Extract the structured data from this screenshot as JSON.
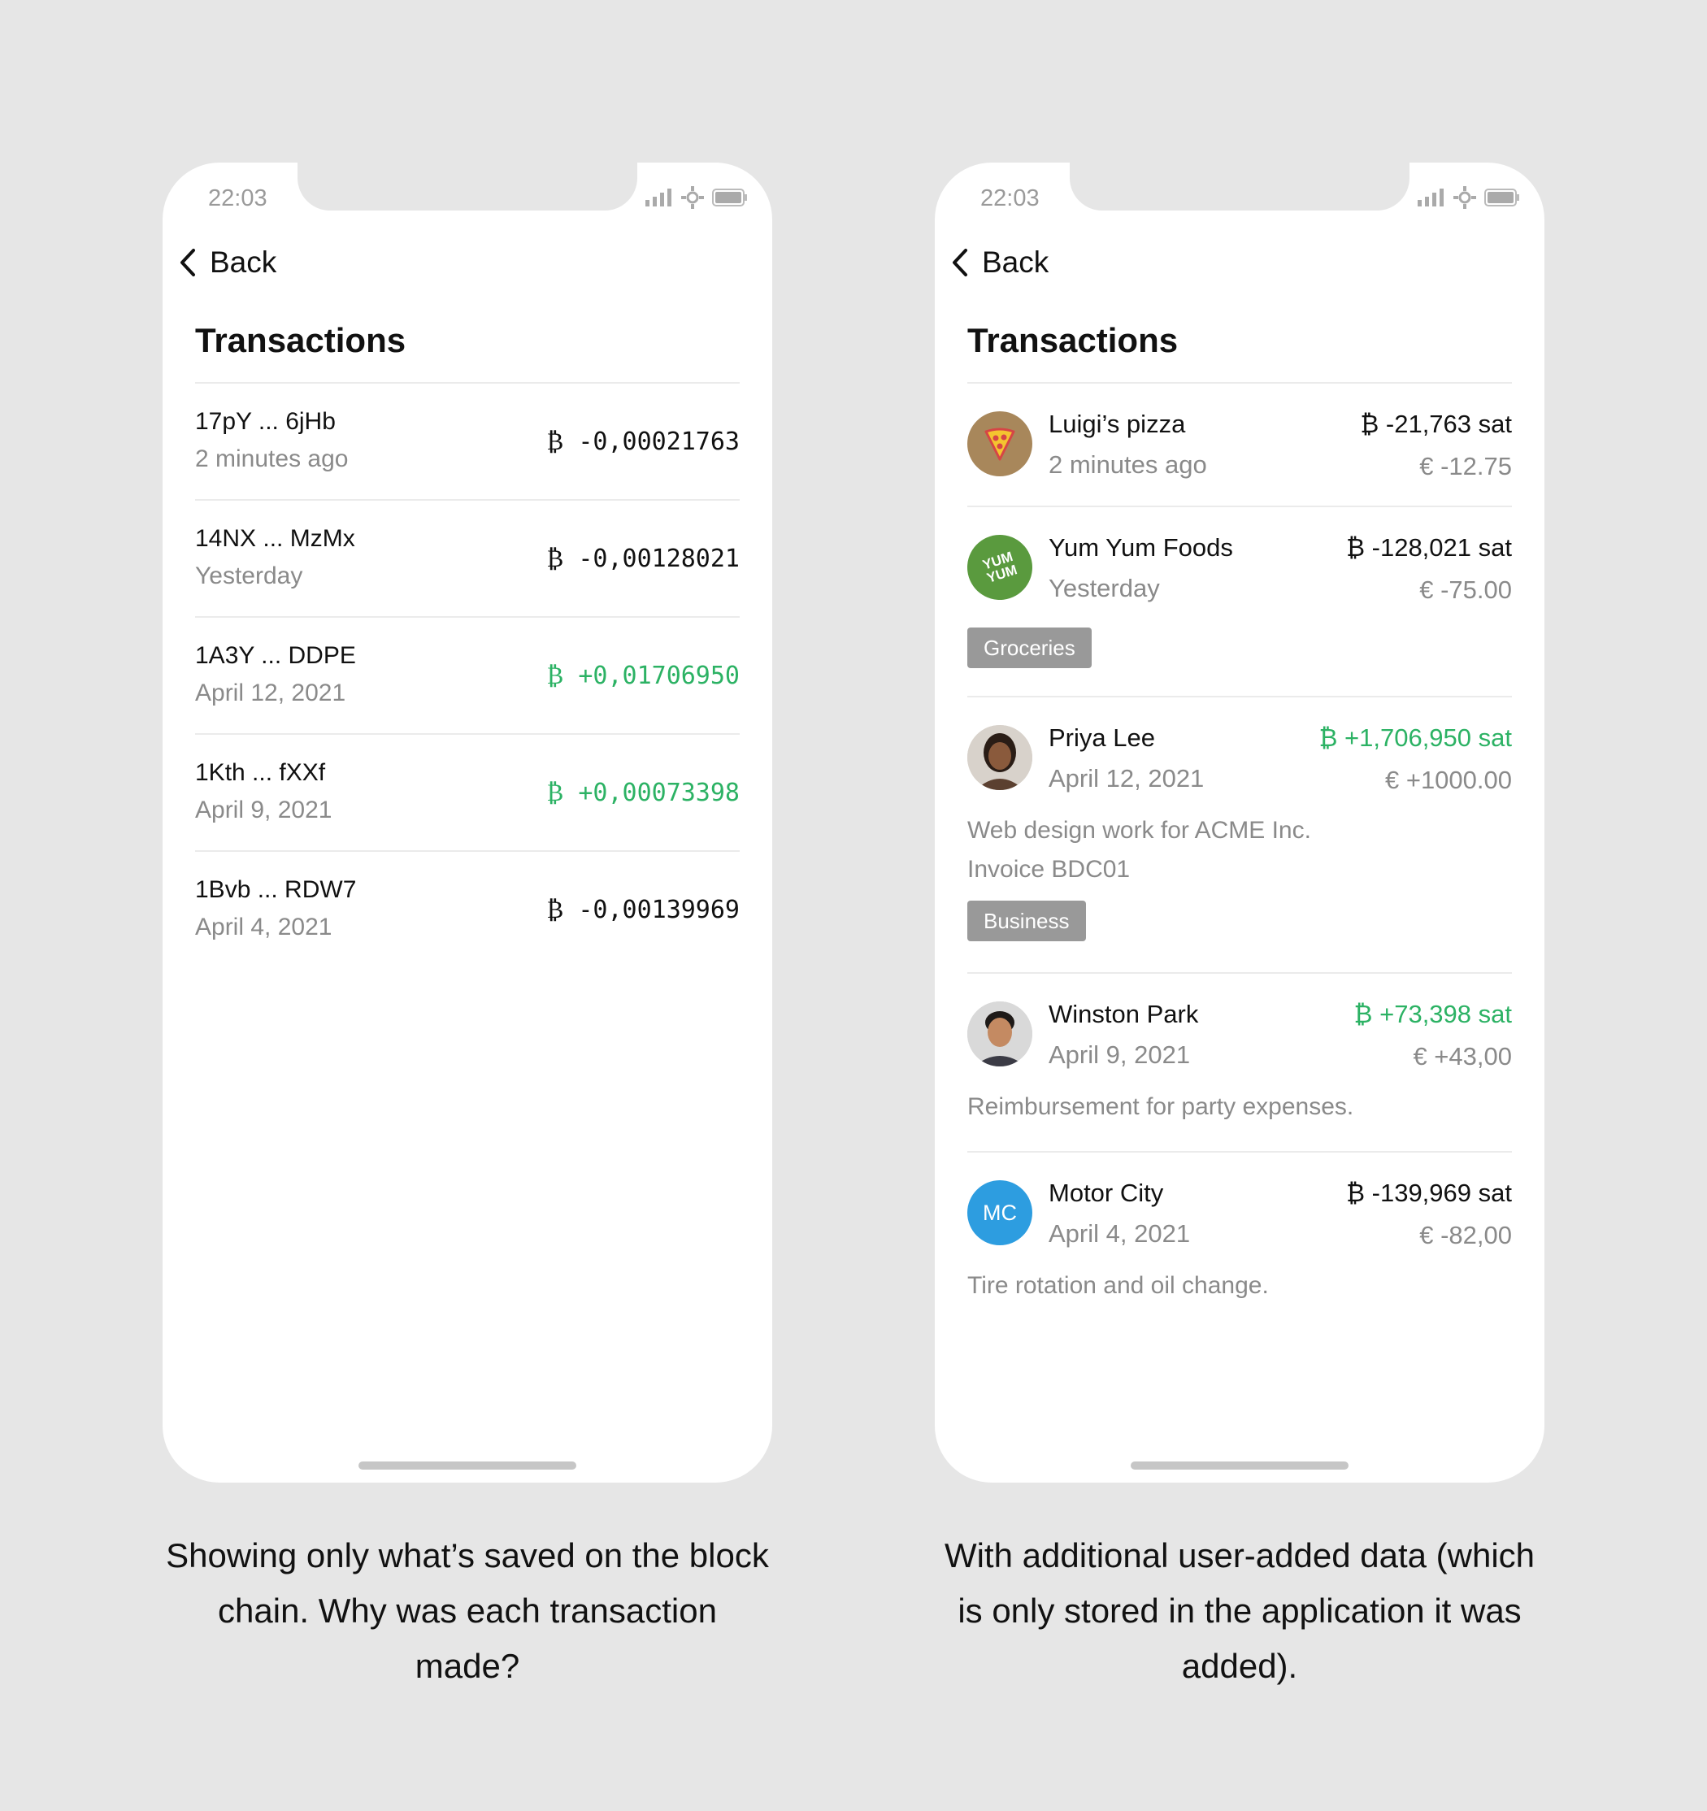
{
  "left": {
    "status_time": "22:03",
    "back_label": "Back",
    "title": "Transactions",
    "rows": [
      {
        "address": "17pY ... 6jHb",
        "date": "2 minutes ago",
        "amount": "₿ -0,00021763",
        "positive": false
      },
      {
        "address": "14NX ... MzMx",
        "date": "Yesterday",
        "amount": "₿ -0,00128021",
        "positive": false
      },
      {
        "address": "1A3Y ... DDPE",
        "date": "April 12, 2021",
        "amount": "₿ +0,01706950",
        "positive": true
      },
      {
        "address": "1Kth ... fXXf",
        "date": "April 9, 2021",
        "amount": "₿ +0,00073398",
        "positive": true
      },
      {
        "address": "1Bvb ... RDW7",
        "date": "April 4, 2021",
        "amount": "₿ -0,00139969",
        "positive": false
      }
    ],
    "caption": "Showing only what’s saved on the block chain. Why was each transaction made?"
  },
  "right": {
    "status_time": "22:03",
    "back_label": "Back",
    "title": "Transactions",
    "rows": [
      {
        "name": "Luigi’s pizza",
        "date": "2 minutes ago",
        "btc": "₿ -21,763 sat",
        "eur": "€ -12.75",
        "positive": false,
        "avatar": "pizza-icon"
      },
      {
        "name": "Yum Yum Foods",
        "date": "Yesterday",
        "btc": "₿ -128,021 sat",
        "eur": "€ -75.00",
        "positive": false,
        "avatar": "yumyum-logo",
        "logo_text_1": "YUM",
        "logo_text_2": "YUM",
        "tag": "Groceries"
      },
      {
        "name": "Priya Lee",
        "date": "April 12, 2021",
        "btc": "₿ +1,706,950 sat",
        "eur": "€ +1000.00",
        "positive": true,
        "avatar": "person-photo",
        "note_line1": "Web design work for ACME Inc.",
        "note_line2": "Invoice BDC01",
        "tag": "Business"
      },
      {
        "name": "Winston Park",
        "date": "April 9, 2021",
        "btc": "₿ +73,398 sat",
        "eur": "€ +43,00",
        "positive": true,
        "avatar": "person-photo",
        "note_line1": "Reimbursement for party expenses."
      },
      {
        "name": "Motor City",
        "date": "April 4, 2021",
        "btc": "₿ -139,969 sat",
        "eur": "€ -82,00",
        "positive": false,
        "avatar": "initials",
        "initials": "MC",
        "note_line1": "Tire rotation and oil change."
      }
    ],
    "caption": "With additional user-added data (which is only stored in the application it was added)."
  },
  "colors": {
    "positive": "#2cb264",
    "background": "#e6e6e6",
    "tag": "#999999",
    "mc_avatar": "#2d9de0",
    "yumyum": "#5a9a3e",
    "pizza_bg": "#a8875b"
  }
}
